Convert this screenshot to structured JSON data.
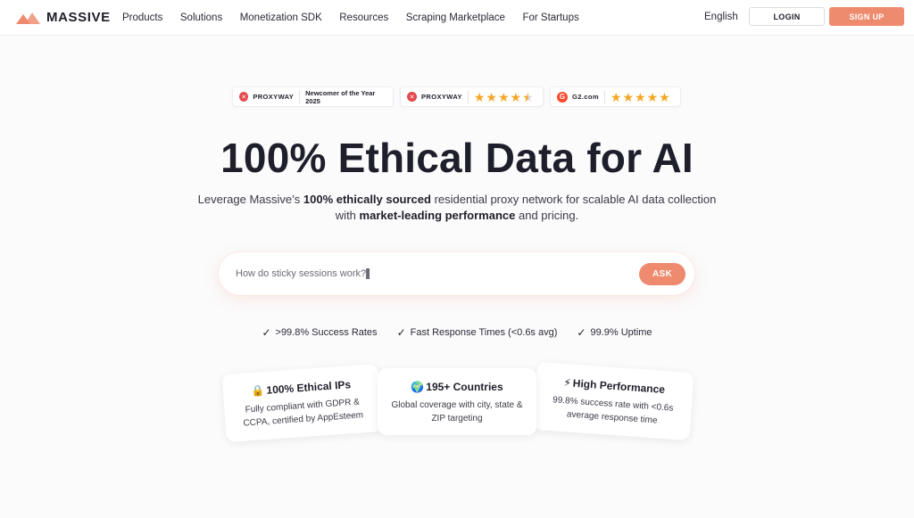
{
  "header": {
    "logo_text": "MASSIVE",
    "nav": [
      "Products",
      "Solutions",
      "Monetization SDK",
      "Resources",
      "Scraping Marketplace",
      "For Startups"
    ],
    "language": "English",
    "login_label": "LOGIN",
    "signup_label": "SIGN UP"
  },
  "badges": {
    "proxyway_award": {
      "brand": "PROXYWAY",
      "note": "Newcomer of the Year 2025"
    },
    "proxyway_rating": {
      "brand": "PROXYWAY",
      "stars": 4.5
    },
    "g2_rating": {
      "brand": "G2.com",
      "stars": 5
    }
  },
  "hero": {
    "title": "100% Ethical Data for AI",
    "sub_1": "Leverage Massive’s ",
    "sub_bold_1": "100% ethically sourced",
    "sub_2": " residential proxy network for scalable AI data collection",
    "sub_3": "with ",
    "sub_bold_2": "market-leading performance",
    "sub_4": " and pricing."
  },
  "ask": {
    "value": "How do sticky sessions work?▌",
    "button": "ASK"
  },
  "features": [
    ">99.8% Success Rates",
    "Fast Response Times (<0.6s avg)",
    "99.9% Uptime"
  ],
  "cards": [
    {
      "emoji": "🔒",
      "title": "100% Ethical IPs",
      "desc": "Fully compliant with GDPR & CCPA, certified by AppEsteem"
    },
    {
      "emoji": "🌍",
      "title": "195+ Countries",
      "desc": "Global coverage with city, state & ZIP targeting"
    },
    {
      "emoji": "⚡",
      "title": "High Performance",
      "desc": "99.8% success rate with <0.6s average response time"
    }
  ],
  "colors": {
    "accent": "#ee8a6d",
    "star": "#f5a623",
    "text": "#1f1f2b"
  }
}
